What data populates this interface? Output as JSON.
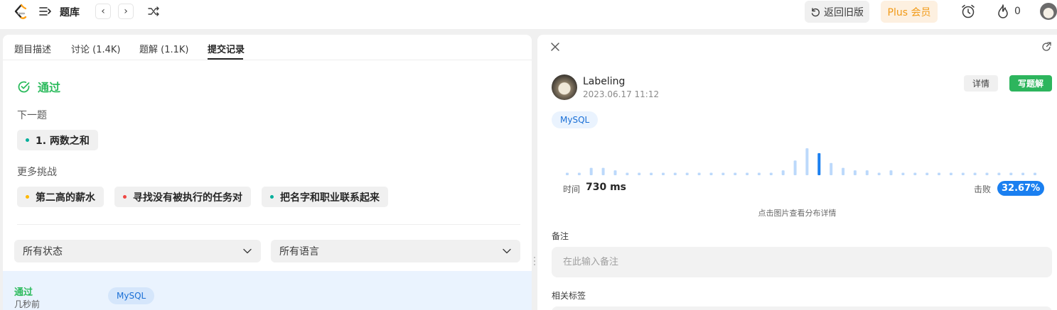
{
  "topbar": {
    "title": "题库",
    "prev_label": "‹",
    "next_label": "›",
    "old_version_label": "返回旧版",
    "plus_label": "Plus 会员",
    "fire_count": "0"
  },
  "left": {
    "tabs": [
      {
        "label": "题目描述"
      },
      {
        "label": "讨论 (1.4K)"
      },
      {
        "label": "题解 (1.1K)"
      },
      {
        "label": "提交记录"
      }
    ],
    "status": "通过",
    "next_label": "下一题",
    "next_problem": "1. 两数之和",
    "more_label": "更多挑战",
    "challenges": [
      {
        "label": "第二高的薪水",
        "color": "#ffb800"
      },
      {
        "label": "寻找没有被执行的任务对",
        "color": "#ef4743"
      },
      {
        "label": "把名字和职业联系起来",
        "color": "#00af9b"
      }
    ],
    "next_problem_color": "#00af9b",
    "status_filter": "所有状态",
    "lang_filter": "所有语言",
    "submission": {
      "status": "通过",
      "time": "几秒前",
      "lang": "MySQL"
    }
  },
  "right": {
    "user_name": "Labeling",
    "date": "2023.06.17 11:12",
    "detail_label": "详情",
    "write_label": "写题解",
    "lang": "MySQL",
    "time_label": "时间",
    "time_value": "730 ms",
    "beat_label": "击败",
    "beat_value": "32.67%",
    "hint": "点击图片查看分布详情",
    "note_label": "备注",
    "note_placeholder": "在此输入备注",
    "tags_label": "相关标签"
  },
  "chart_data": {
    "type": "bar",
    "values": [
      1,
      1,
      3,
      3,
      2,
      1,
      1,
      1,
      1,
      1,
      1,
      1,
      1,
      1,
      1,
      1,
      1,
      1,
      2,
      6,
      11,
      9,
      5,
      3,
      2,
      2,
      1,
      2,
      1,
      1,
      1,
      1,
      1,
      1,
      1,
      1,
      1,
      1,
      1,
      1
    ],
    "highlight_index": 21,
    "colors": {
      "normal": "#bcd9fb",
      "highlight": "#1a7ff0"
    }
  }
}
